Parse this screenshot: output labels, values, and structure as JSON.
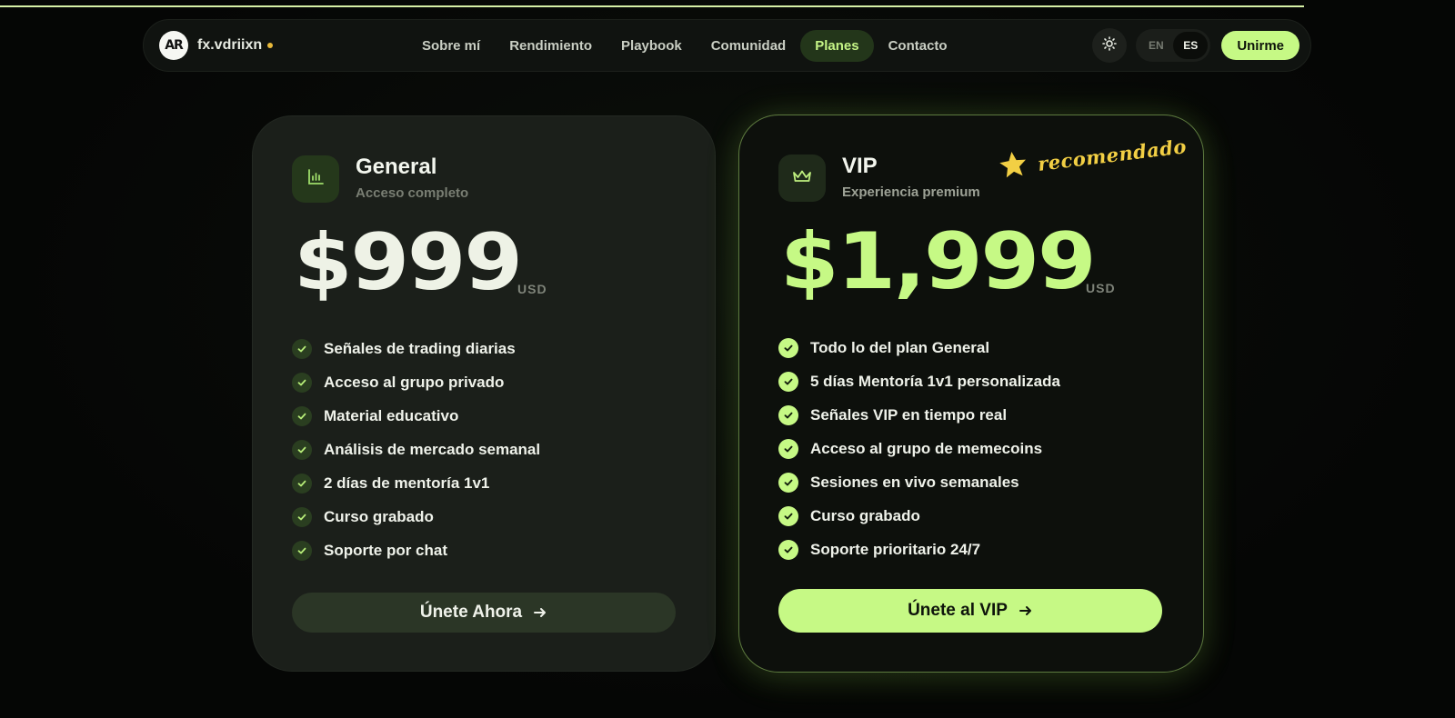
{
  "brand": {
    "name": "fx.vdriixn",
    "logo_text": "AR"
  },
  "nav": {
    "links": [
      "Sobre mí",
      "Rendimiento",
      "Playbook",
      "Comunidad",
      "Planes",
      "Contacto"
    ],
    "active": "Planes",
    "theme_icon": "sun-icon",
    "languages": [
      "EN",
      "ES"
    ],
    "active_language": "ES",
    "cta": "Unirme"
  },
  "plans": {
    "general": {
      "icon": "bar-chart-icon",
      "name": "General",
      "subtitle": "Acceso completo",
      "price": "$999",
      "currency": "USD",
      "features": [
        "Señales de trading diarias",
        "Acceso al grupo privado",
        "Material educativo",
        "Análisis de mercado semanal",
        "2 días de mentoría 1v1",
        "Curso grabado",
        "Soporte por chat"
      ],
      "cta": "Únete Ahora"
    },
    "vip": {
      "icon": "crown-icon",
      "name": "VIP",
      "subtitle": "Experiencia premium",
      "badge": "recomendado",
      "price": "$1,999",
      "currency": "USD",
      "features": [
        "Todo lo del plan General",
        "5 días Mentoría 1v1 personalizada",
        "Señales VIP en tiempo real",
        "Acceso al grupo de memecoins",
        "Sesiones en vivo semanales",
        "Curso grabado",
        "Soporte prioritario 24/7"
      ],
      "cta": "Únete al VIP"
    }
  },
  "colors": {
    "accent": "#c6f985",
    "badge": "#f2cf44",
    "background": "#060806"
  }
}
